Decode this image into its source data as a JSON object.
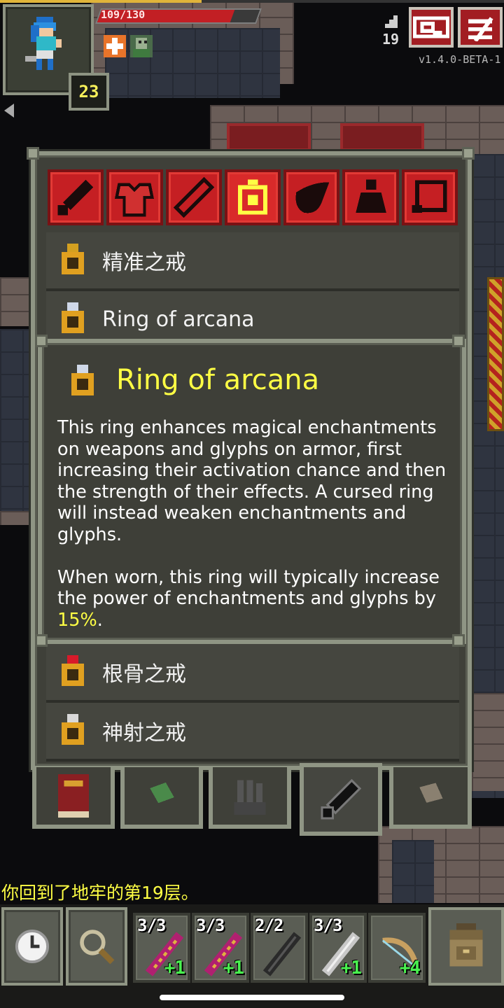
{
  "hud": {
    "hp_text": "109/130",
    "hp_fraction": 0.84,
    "hero_level": "23",
    "depth": "19",
    "version": "v1.4.0-BETA-1",
    "buffs": [
      "bless-buff-icon",
      "ally-portrait-icon"
    ],
    "buttons": [
      "journal-search-icon",
      "menu-icon"
    ]
  },
  "window": {
    "category_tabs": [
      "melee-weapon",
      "armor",
      "wand",
      "ring",
      "artifact",
      "potion",
      "scroll"
    ],
    "active_tab": "ring",
    "items": [
      {
        "label": "精准之戒",
        "gem": "#d4a020"
      },
      {
        "label": "Ring of arcana",
        "gem": "#cfd8e8"
      },
      {
        "label": "根骨之戒",
        "gem": "#d81a2a"
      },
      {
        "label": "神射之戒",
        "gem": "#d8d8d8"
      }
    ]
  },
  "popup": {
    "title": "Ring of arcana",
    "desc_p1": "This ring enhances magical enchantments on weapons and glyphs on armor, first increasing their activation chance and then the strength of their effects. A cursed ring will instead weaken enchantments and glyphs.",
    "desc_p2_before": "When worn, this ring will typically increase the power of enchantments and glyphs by",
    "desc_p2_highlight": "15%",
    "desc_p2_after": "."
  },
  "inventory_tabs": [
    "spellbook-icon",
    "green-scroll-icon",
    "gloves-icon",
    "sword-icon",
    "parchment-icon"
  ],
  "log": {
    "message": "你回到了地牢的第19层。"
  },
  "toolbar": {
    "quickslots": [
      {
        "charges": "3/3",
        "level": "+1",
        "item": "wand-magenta"
      },
      {
        "charges": "3/3",
        "level": "+1",
        "item": "wand-magenta"
      },
      {
        "charges": "2/2",
        "level": "",
        "item": "wand-dark"
      },
      {
        "charges": "3/3",
        "level": "+1",
        "item": "wand-grey"
      },
      {
        "charges": "",
        "level": "+4",
        "item": "bow"
      }
    ]
  },
  "colors": {
    "accent_yellow": "#ffff44",
    "tab_red": "#c51f23",
    "panel": "#3f4039",
    "frame": "#8f9584"
  }
}
